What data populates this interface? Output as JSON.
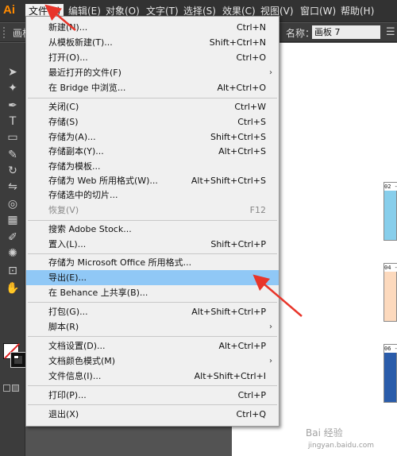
{
  "app": {
    "logo": "Ai"
  },
  "menubar": {
    "items": [
      "文件(F)",
      "编辑(E)",
      "对象(O)",
      "文字(T)",
      "选择(S)",
      "效果(C)",
      "视图(V)",
      "窗口(W)",
      "帮助(H)"
    ]
  },
  "controlbar": {
    "left_label": "画板",
    "name_label": "名称：",
    "name_value": "画板 7"
  },
  "file_menu": {
    "items": [
      {
        "label": "新建(N)...",
        "shortcut": "Ctrl+N"
      },
      {
        "label": "从模板新建(T)...",
        "shortcut": "Shift+Ctrl+N"
      },
      {
        "label": "打开(O)...",
        "shortcut": "Ctrl+O"
      },
      {
        "label": "最近打开的文件(F)",
        "shortcut": ""
      },
      {
        "label": "在 Bridge 中浏览...",
        "shortcut": "Alt+Ctrl+O"
      },
      {
        "label": "关闭(C)",
        "shortcut": "Ctrl+W"
      },
      {
        "label": "存储(S)",
        "shortcut": "Ctrl+S"
      },
      {
        "label": "存储为(A)...",
        "shortcut": "Shift+Ctrl+S"
      },
      {
        "label": "存储副本(Y)...",
        "shortcut": "Alt+Ctrl+S"
      },
      {
        "label": "存储为模板...",
        "shortcut": ""
      },
      {
        "label": "存储为 Web 所用格式(W)...",
        "shortcut": "Alt+Shift+Ctrl+S"
      },
      {
        "label": "存储选中的切片...",
        "shortcut": ""
      },
      {
        "label": "恢复(V)",
        "shortcut": "F12"
      },
      {
        "label": "搜索 Adobe Stock...",
        "shortcut": ""
      },
      {
        "label": "置入(L)...",
        "shortcut": "Shift+Ctrl+P"
      },
      {
        "label": "存储为 Microsoft Office 所用格式...",
        "shortcut": ""
      },
      {
        "label": "导出(E)...",
        "shortcut": ""
      },
      {
        "label": "在 Behance 上共享(B)...",
        "shortcut": ""
      },
      {
        "label": "打包(G)...",
        "shortcut": "Alt+Shift+Ctrl+P"
      },
      {
        "label": "脚本(R)",
        "shortcut": ""
      },
      {
        "label": "文档设置(D)...",
        "shortcut": "Alt+Ctrl+P"
      },
      {
        "label": "文档颜色模式(M)",
        "shortcut": ""
      },
      {
        "label": "文件信息(I)...",
        "shortcut": "Alt+Shift+Ctrl+I"
      },
      {
        "label": "打印(P)...",
        "shortcut": "Ctrl+P"
      },
      {
        "label": "退出(X)",
        "shortcut": "Ctrl+Q"
      }
    ]
  },
  "thumbnails": [
    {
      "label": "02 - ",
      "color": "#87ceeb"
    },
    {
      "label": "04 - ",
      "color": "#fcd9bd"
    },
    {
      "label": "06 - ",
      "color": "#2a5caa"
    }
  ],
  "watermark": {
    "text": "Bai 经验",
    "sub": "jingyan.baidu.com"
  },
  "colors": {
    "accent": "#ff8a00",
    "highlight": "#90c8f6",
    "arrow": "#e8352a"
  }
}
